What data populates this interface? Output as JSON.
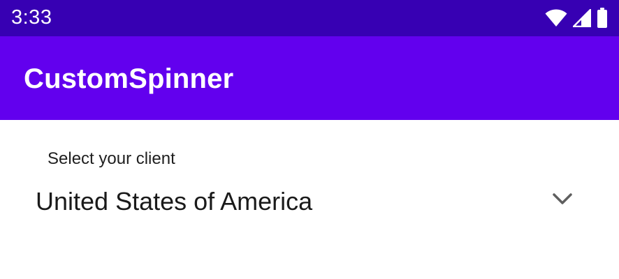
{
  "status_bar": {
    "time": "3:33",
    "icons": [
      "wifi-icon",
      "cell-signal-icon",
      "battery-icon"
    ]
  },
  "app_bar": {
    "title": "CustomSpinner",
    "color": "#6200ee"
  },
  "form": {
    "label": "Select your client",
    "spinner": {
      "selected_value": "United States of America",
      "icon": "chevron-down-icon"
    }
  },
  "colors": {
    "status_bar": "#3700b3",
    "app_bar": "#6200ee",
    "background": "#ffffff"
  }
}
